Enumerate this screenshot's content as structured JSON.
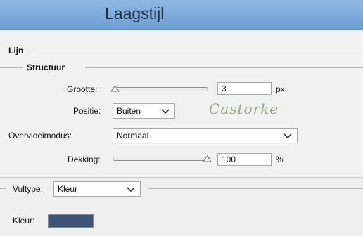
{
  "title": "Laagstijl",
  "section": "Lijn",
  "subsection": "Structuur",
  "size": {
    "label": "Grootte:",
    "value": "3",
    "unit": "px",
    "slider_fraction": 0.0
  },
  "position": {
    "label": "Positie:",
    "value": "Buiten"
  },
  "blend": {
    "label": "Overvloeimodus:",
    "value": "Normaal"
  },
  "opacity": {
    "label": "Dekking:",
    "value": "100",
    "unit": "%",
    "slider_fraction": 1.0
  },
  "filltype": {
    "label": "Vultype:",
    "value": "Kleur"
  },
  "color": {
    "label": "Kleur:",
    "swatch": "#3d5478"
  },
  "watermark": "Castorke",
  "colors": {
    "titlebar": "#7aaade",
    "background": "#f1f1f1"
  }
}
